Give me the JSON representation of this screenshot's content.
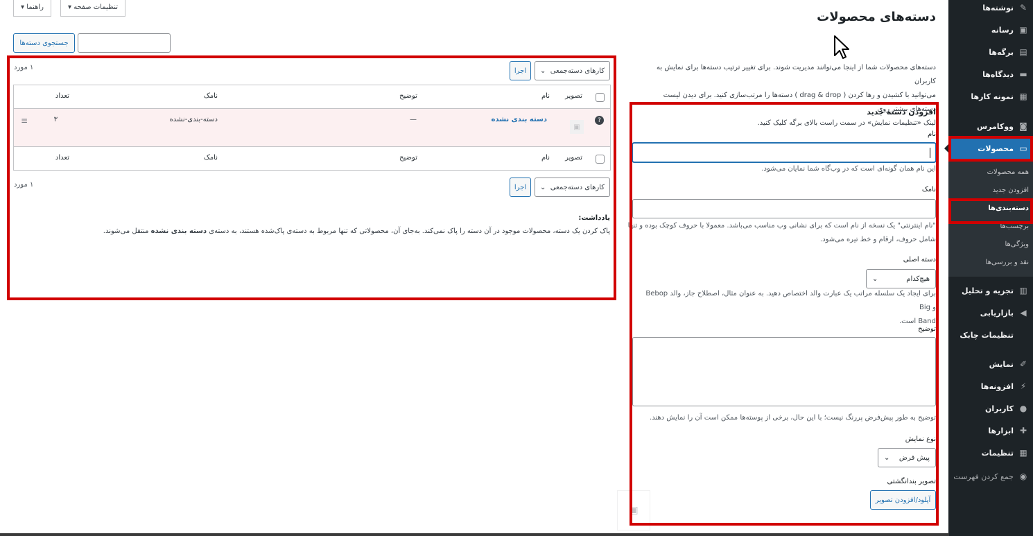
{
  "sidebar": {
    "items": [
      {
        "label": "نوشته‌ها",
        "icon": "pin-icon"
      },
      {
        "label": "رسانه",
        "icon": "media-icon"
      },
      {
        "label": "برگه‌ها",
        "icon": "page-icon"
      },
      {
        "label": "دیدگاه‌ها",
        "icon": "comment-icon"
      },
      {
        "label": "نمونه کارها",
        "icon": "portfolio-icon"
      },
      {
        "label": "ووکامرس",
        "icon": "woo-icon"
      },
      {
        "label": "محصولات",
        "icon": "archive-icon"
      },
      {
        "label": "تجزیه و تحلیل",
        "icon": "chart-icon"
      },
      {
        "label": "بازاریابی",
        "icon": "megaphone-icon"
      },
      {
        "label": "تنظیمات چابک",
        "icon": ""
      },
      {
        "label": "نمایش",
        "icon": "brush-icon"
      },
      {
        "label": "افزونه‌ها",
        "icon": "plugin-icon"
      },
      {
        "label": "کاربران",
        "icon": "user-icon"
      },
      {
        "label": "ابزارها",
        "icon": "wrench-icon"
      },
      {
        "label": "تنظیمات",
        "icon": "settings-icon"
      },
      {
        "label": "جمع کردن فهرست",
        "icon": "collapse-icon"
      }
    ],
    "submenu": [
      "همه محصولات",
      "افزودن جدید",
      "دسته‌بندی‌ها",
      "برچسب‌ها",
      "ویژگی‌ها",
      "نقد و بررسی‌ها"
    ]
  },
  "header": {
    "screen_options": "تنظیمات صفحه ▾",
    "help": "راهنما ▾",
    "title": "دسته‌های محصولات"
  },
  "intro": {
    "line1": "دسته‌های محصولات شما از اینجا می‌توانند مدیریت شوند. برای تغییر ترتیب دسته‌ها برای نمایش به کاربران",
    "line2": "می‌توانید با کشیدن و رها کردن ( drag & drop ) دسته‌ها را مرتب‌سازی کنید. برای دیدن لیست دسته‌های بیشتر روی",
    "line3": "لینک «تنظیمات نمایش» در سمت راست بالای برگه کلیک کنید."
  },
  "search": {
    "button": "جستجوی دسته‌ها",
    "value": ""
  },
  "form": {
    "title": "افزودن دسته جدید",
    "name_label": "نام",
    "name_help": "این نام همان گونه‌ای است که در وب‌گاه شما نمایان می‌شود.",
    "slug_label": "نامک",
    "slug_help1": "\"نام اینترنتی\" یک نسخه از نام است که برای نشانی وب مناسب می‌باشد. معمولا با حروف کوچک بوده و تنها",
    "slug_help2": "شامل حروف، ارقام و خط تیره می‌شود.",
    "parent_label": "دسته اصلی",
    "parent_value": "هیچ‌کدام",
    "parent_help1": "برای ایجاد یک سلسله مراتب یک عبارت والد اختصاص دهید. به عنوان مثال، اصطلاح جاز، والد Bebop و Big",
    "parent_help2": "Band است.",
    "desc_label": "توضیح",
    "desc_help": "توضیح به طور پیش‌فرض پررنگ نیست؛ با این حال، برخی از پوسته‌ها ممکن است آن را نمایش دهند.",
    "display_label": "نوع نمایش",
    "display_value": "پیش فرض",
    "thumb_label": "تصویر بندانگشتی",
    "upload_button": "آپلود/افزودن تصویر"
  },
  "table": {
    "bulk_label": "کارهای دسته‌جمعی",
    "apply": "اجرا",
    "count": "۱ مورد",
    "columns": {
      "image": "تصویر",
      "name": "نام",
      "description": "توضیح",
      "slug": "نامک",
      "count": "تعداد"
    },
    "rows": [
      {
        "name": "دسته بندی نشده",
        "description": "—",
        "slug": "دسته-بندی-نشده",
        "count": "۳"
      }
    ]
  },
  "note": {
    "title": "یادداشت:",
    "text_a": "پاک کردن یک دسته، محصولات موجود در آن دسته را پاک نمی‌کند. به‌جای آن، محصولاتی که تنها مربوط به دسته‌ی پاک‌شده هستند، به دسته‌ی ",
    "text_b": "دسته بندی نشده",
    "text_c": " منتقل می‌شوند."
  },
  "colors": {
    "accent": "#2271b1",
    "highlight_box": "#d10000",
    "sidebar_bg": "#1d2327"
  }
}
